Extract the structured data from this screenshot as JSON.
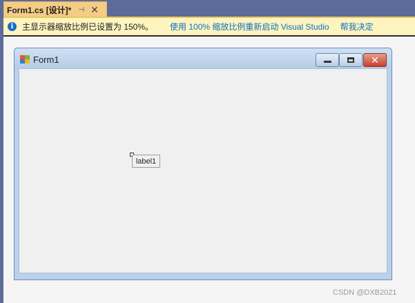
{
  "tab": {
    "title": "Form1.cs [设计]*",
    "pin_glyph": "⊣",
    "close_glyph": "✕"
  },
  "infobar": {
    "icon": "i",
    "message": "主显示器缩放比例已设置为 150%。",
    "restart_link": "使用 100% 缩放比例重新启动 Visual Studio",
    "decide_link": "帮我决定"
  },
  "form": {
    "title": "Form1",
    "close_glyph": "✕",
    "label_text": "label1"
  },
  "watermark": "CSDN @DXB2021",
  "colors": {
    "tab_bg": "#f5cc84",
    "infobar_bg": "#fdf4bf",
    "link": "#0e70c0",
    "form_frame": "#b9d1ea",
    "close_button": "#c6402a"
  }
}
